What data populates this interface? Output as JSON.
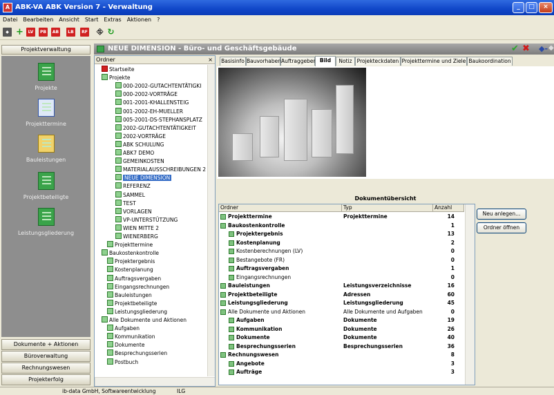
{
  "window": {
    "title": "ABK-VA   ABK Version 7 - Verwaltung"
  },
  "menu": [
    "Datei",
    "Bearbeiten",
    "Ansicht",
    "Start",
    "Extras",
    "Aktionen",
    "?"
  ],
  "toolbar": {
    "icons": [
      "new-object-icon",
      "add-icon",
      "lv-icon",
      "pb-icon",
      "ab-icon",
      "lb-icon",
      "rf-icon",
      "network-icon",
      "refresh-icon"
    ],
    "labels": {
      "lv": "LV",
      "pb": "PB",
      "ab": "AB",
      "lb": "LB",
      "rf": "RF"
    }
  },
  "left": {
    "header": "Projektverwaltung",
    "nav": [
      {
        "label": "Projekte"
      },
      {
        "label": "Projekttermine"
      },
      {
        "label": "Bauleistungen"
      },
      {
        "label": "Projektbeteiligte"
      },
      {
        "label": "Leistungsgliederung"
      }
    ],
    "bottom_buttons": [
      "Dokumente + Aktionen",
      "Büroverwaltung",
      "Rechnungswesen",
      "Projekterfolg"
    ]
  },
  "main": {
    "title": "NEUE DIMENSION - Büro- und Geschäftsgebäude"
  },
  "tree": {
    "header": "Ordner",
    "close": "×",
    "items": [
      {
        "label": "Startseite",
        "level": 0
      },
      {
        "label": "Projekte",
        "level": 0
      },
      {
        "label": "000-2002-GUTACHTENTÄTIGKI",
        "level": 2
      },
      {
        "label": "000-2002-VORTRÄGE",
        "level": 2
      },
      {
        "label": "001-2001-KHALLENSTEIG",
        "level": 2
      },
      {
        "label": "001-2002-EH-MUELLER",
        "level": 2
      },
      {
        "label": "005-2001-DS-STEPHANSPLATZ",
        "level": 2
      },
      {
        "label": "2002-GUTACHTENTÄTIGKEIT",
        "level": 2
      },
      {
        "label": "2002-VORTRÄGE",
        "level": 2
      },
      {
        "label": "ABK SCHULUNG",
        "level": 2
      },
      {
        "label": "ABK7 DEMO",
        "level": 2
      },
      {
        "label": "GEMEINKOSTEN",
        "level": 2
      },
      {
        "label": "MATERIALAUSSCHREIBUNGEN 2",
        "level": 2
      },
      {
        "label": "NEUE DIMENSION",
        "level": 2,
        "selected": true
      },
      {
        "label": "REFERENZ",
        "level": 2
      },
      {
        "label": "SAMMEL",
        "level": 2
      },
      {
        "label": "TEST",
        "level": 2
      },
      {
        "label": "VORLAGEN",
        "level": 2
      },
      {
        "label": "VP-UNTERSTÜTZUNG",
        "level": 2
      },
      {
        "label": "WIEN MITTE 2",
        "level": 2
      },
      {
        "label": "WIENERBERG",
        "level": 2
      },
      {
        "label": "Projekttermine",
        "level": 1
      },
      {
        "label": "Baukostenkontrolle",
        "level": 0
      },
      {
        "label": "Projektergebnis",
        "level": 1
      },
      {
        "label": "Kostenplanung",
        "level": 1
      },
      {
        "label": "Auftragsvergaben",
        "level": 1
      },
      {
        "label": "Eingangsrechnungen",
        "level": 1
      },
      {
        "label": "Bauleistungen",
        "level": 1
      },
      {
        "label": "Projektbeteiligte",
        "level": 1
      },
      {
        "label": "Leistungsgliederung",
        "level": 1
      },
      {
        "label": "Alle Dokumente und Aktionen",
        "level": 0
      },
      {
        "label": "Aufgaben",
        "level": 1
      },
      {
        "label": "Kommunikation",
        "level": 1
      },
      {
        "label": "Dokumente",
        "level": 1
      },
      {
        "label": "Besprechungsserien",
        "level": 1
      },
      {
        "label": "Postbuch",
        "level": 1
      }
    ]
  },
  "tabs": [
    "Basisinfo",
    "Bauvorhaben",
    "Auftraggeber",
    "Bild",
    "Notiz",
    "Projekteckdaten",
    "Projekttermine und Ziele",
    "Baukoordination"
  ],
  "docs": {
    "title": "Dokumentübersicht",
    "columns": [
      "Ordner",
      "Typ",
      "Anzahl"
    ],
    "rows": [
      {
        "ordner": "Projekttermine",
        "typ": "Projekttermine",
        "anzahl": "14",
        "bold": true,
        "level": 0
      },
      {
        "ordner": "Baukostenkontrolle",
        "typ": "",
        "anzahl": "1",
        "bold": true,
        "level": 0
      },
      {
        "ordner": "Projektergebnis",
        "typ": "",
        "anzahl": "13",
        "bold": true,
        "level": 1
      },
      {
        "ordner": "Kostenplanung",
        "typ": "",
        "anzahl": "2",
        "bold": true,
        "level": 1
      },
      {
        "ordner": "Kostenberechnungen (LV)",
        "typ": "",
        "anzahl": "0",
        "bold": false,
        "level": 1
      },
      {
        "ordner": "Bestangebote (FR)",
        "typ": "",
        "anzahl": "0",
        "bold": false,
        "level": 1
      },
      {
        "ordner": "Auftragsvergaben",
        "typ": "",
        "anzahl": "1",
        "bold": true,
        "level": 1
      },
      {
        "ordner": "Eingangsrechnungen",
        "typ": "",
        "anzahl": "0",
        "bold": false,
        "level": 1
      },
      {
        "ordner": "Bauleistungen",
        "typ": "Leistungsverzeichnisse",
        "anzahl": "16",
        "bold": true,
        "level": 0
      },
      {
        "ordner": "Projektbeteiligte",
        "typ": "Adressen",
        "anzahl": "60",
        "bold": true,
        "level": 0
      },
      {
        "ordner": "Leistungsgliederung",
        "typ": "Leistungsgliederung",
        "anzahl": "45",
        "bold": true,
        "level": 0
      },
      {
        "ordner": "Alle Dokumente und Aktionen",
        "typ": "Alle Dokumente und Aufgaben",
        "anzahl": "0",
        "bold": false,
        "level": 0
      },
      {
        "ordner": "Aufgaben",
        "typ": "Dokumente",
        "anzahl": "19",
        "bold": true,
        "level": 1
      },
      {
        "ordner": "Kommunikation",
        "typ": "Dokumente",
        "anzahl": "26",
        "bold": true,
        "level": 1
      },
      {
        "ordner": "Dokumente",
        "typ": "Dokumente",
        "anzahl": "40",
        "bold": true,
        "level": 1
      },
      {
        "ordner": "Besprechungsserien",
        "typ": "Besprechungsserien",
        "anzahl": "36",
        "bold": true,
        "level": 1
      },
      {
        "ordner": "Rechnungswesen",
        "typ": "",
        "anzahl": "8",
        "bold": true,
        "level": 0
      },
      {
        "ordner": "Angebote",
        "typ": "",
        "anzahl": "3",
        "bold": true,
        "level": 1
      },
      {
        "ordner": "Aufträge",
        "typ": "",
        "anzahl": "3",
        "bold": true,
        "level": 1
      }
    ]
  },
  "buttons": {
    "new": "Neu anlegen...",
    "open": "Ordner öffnen"
  },
  "status": {
    "left": "ib-data GmbH, Softwareentwicklung",
    "right": "ILG"
  },
  "colors": {
    "title_blue": "#1046c8",
    "selection": "#316ac5",
    "nav_bg": "#8e8e8e",
    "ok_green": "#2aa52a",
    "cancel_red": "#d01818"
  }
}
